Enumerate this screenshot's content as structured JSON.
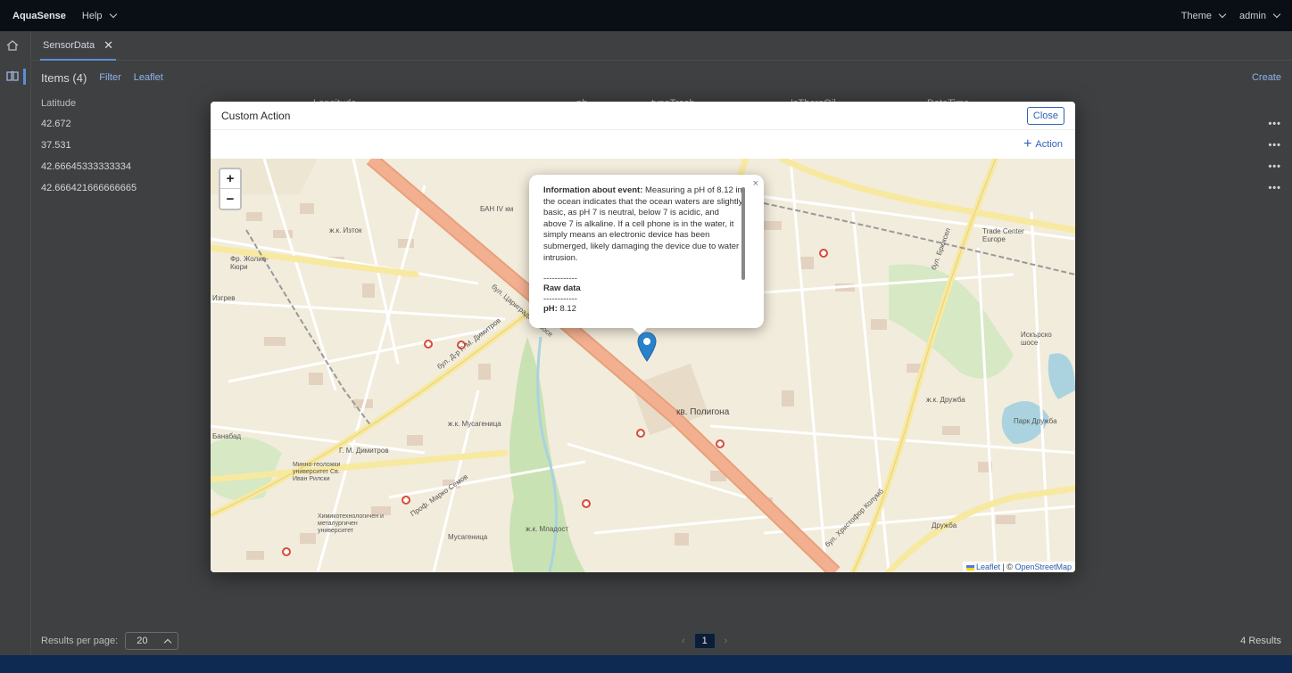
{
  "topbar": {
    "brand": "AquaSense",
    "help": "Help",
    "theme": "Theme",
    "user": "admin"
  },
  "tabs": [
    {
      "label": "SensorData"
    }
  ],
  "toolbar": {
    "title": "Items (4)",
    "filter": "Filter",
    "leaflet": "Leaflet",
    "create": "Create"
  },
  "table": {
    "columns": [
      "Latitude",
      "Longitude",
      "ph",
      "typeTrash",
      "IsThereOil",
      "DateTime"
    ],
    "rows": [
      {
        "latitude": "42.672"
      },
      {
        "latitude": "37.531"
      },
      {
        "latitude": "42.66645333333334"
      },
      {
        "latitude": "42.666421666666665"
      }
    ]
  },
  "footer": {
    "results_per_page_label": "Results per page:",
    "per_page_value": "20",
    "current_page": "1",
    "results_count": "4 Results"
  },
  "modal": {
    "title": "Custom Action",
    "close_label": "Close",
    "action_label": "Action"
  },
  "map": {
    "zoom_in": "+",
    "zoom_out": "−",
    "popup": {
      "info_label": "Information about event:",
      "info_text": "Measuring a pH of 8.12 in the ocean indicates that the ocean waters are slightly basic, as pH 7 is neutral, below 7 is acidic, and above 7 is alkaline. If a cell phone is in the water, it simply means an electronic device has been submerged, likely damaging the device due to water intrusion.",
      "separator": "------------",
      "raw_data_label": "Raw data",
      "ph_label": "pH:",
      "ph_value": "8.12",
      "close": "×"
    },
    "labels": {
      "izgrev": "ж.к. Изток",
      "poligona": "кв. Полигона",
      "musagenitsa": "ж.к. Мусагеница",
      "musagenitsa2": "Мусагеница",
      "mladost": "ж.к. Младост",
      "druzhba": "ж.к. Дружба",
      "druzhba2": "Дружба",
      "park_druzhba": "Парк Дружба",
      "iskarsko": "Искърско шосе",
      "trade_center": "Trade Center Europe",
      "gm_dimitrov": "Г. М. Димитров",
      "ban": "БАН IV км",
      "fr_kyuri": "Фр. Жолио-Кюри",
      "izgrev2": "Изгрев",
      "simeonovo": "Банабад",
      "dimitrov_blvd": "бул. Д-р Г. М. Димитров",
      "tsarigradsko": "бул. Цариградско шосе",
      "bratya_buxton": "бул. Брюксел",
      "hristofor": "бул. Христофор Колумб",
      "marko_semov": "Проф. Марко Семов",
      "uni_chem": "Химикотехнологичен и металургичен университет",
      "uni_geo": "Минно-геоложки университет Св. Иван Рилски"
    },
    "attribution": {
      "leaflet": "Leaflet",
      "separator": " | © ",
      "osm": "OpenStreetMap"
    }
  },
  "colors": {
    "accent": "#2d62b8",
    "marker": "#2a81cb",
    "main_road": "#f0a37a",
    "secondary_road": "#f6e79e",
    "park": "#c8e3ba",
    "building": "#e5d3c4"
  }
}
